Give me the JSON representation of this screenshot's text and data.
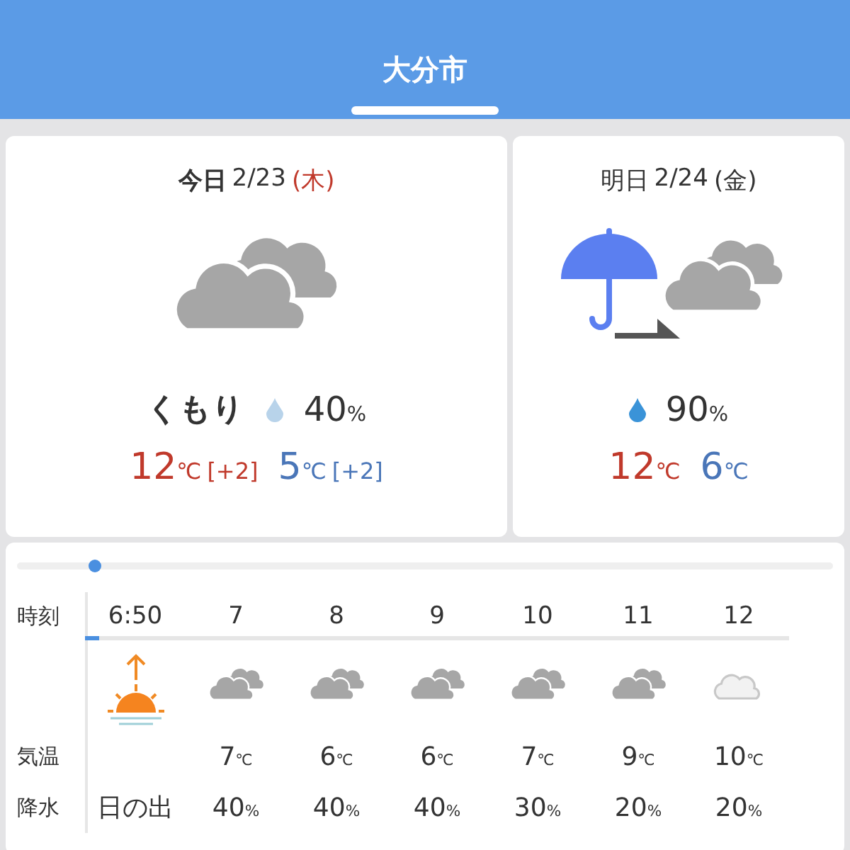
{
  "header": {
    "title": "大分市",
    "tab_indicator": true
  },
  "days": [
    {
      "day": "今日",
      "date": "2/23",
      "weekday": "(木)",
      "holiday": true,
      "kind": "cloudy",
      "condition": "くもり",
      "color": "#b8d3ea",
      "precip": "40",
      "precip_unit": "%",
      "high": {
        "value": "12",
        "unit": "℃",
        "diff": "[+2]"
      },
      "low": {
        "value": "5",
        "unit": "℃",
        "diff": "[+2]"
      }
    },
    {
      "day": "明日",
      "date": "2/24",
      "weekday": "(金)",
      "holiday": false,
      "kind": "rain-then-cloudy",
      "color": "#3a93d8",
      "precip": "90",
      "precip_unit": "%",
      "high": {
        "value": "12",
        "unit": "℃"
      },
      "low": {
        "value": "6",
        "unit": "℃"
      }
    }
  ],
  "timeline": {
    "level": 0.095
  },
  "hourly": {
    "labels": [
      "時刻",
      "気温",
      "降水"
    ],
    "time_progress": {
      "level": 0.02
    },
    "hours": [
      {
        "time": "6:50",
        "kind": "sunrise",
        "precip": "日の出"
      },
      {
        "time": "7",
        "kind": "cloudy",
        "temp": "7",
        "temp_unit": "℃",
        "precip": "40",
        "precip_unit": "%"
      },
      {
        "time": "8",
        "kind": "cloudy",
        "temp": "6",
        "temp_unit": "℃",
        "precip": "40",
        "precip_unit": "%"
      },
      {
        "time": "9",
        "kind": "cloudy",
        "temp": "6",
        "temp_unit": "℃",
        "precip": "40",
        "precip_unit": "%"
      },
      {
        "time": "10",
        "kind": "cloudy",
        "temp": "7",
        "temp_unit": "℃",
        "precip": "30",
        "precip_unit": "%"
      },
      {
        "time": "11",
        "kind": "cloudy",
        "temp": "9",
        "temp_unit": "℃",
        "precip": "20",
        "precip_unit": "%"
      },
      {
        "time": "12",
        "kind": "cloud-light",
        "temp": "10",
        "temp_unit": "℃",
        "precip": "20",
        "precip_unit": "%"
      }
    ]
  }
}
